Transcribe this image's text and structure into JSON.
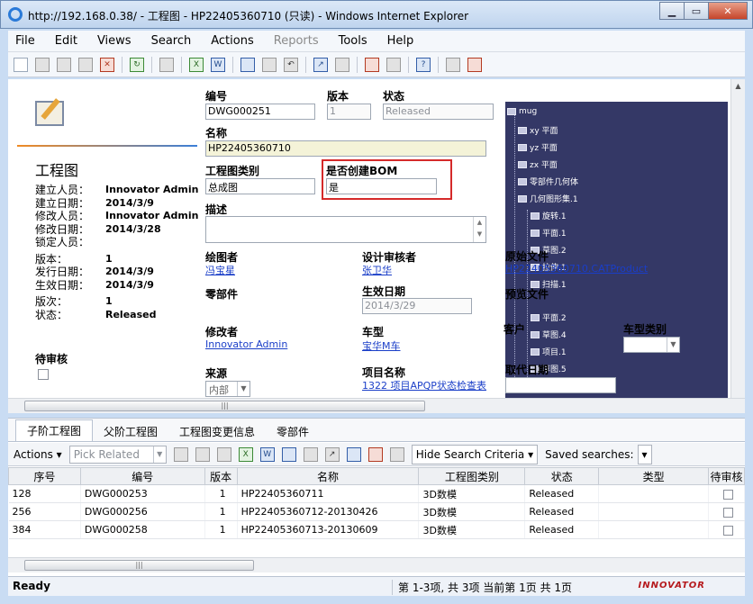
{
  "window": {
    "title": "http://192.168.0.38/ - 工程图 - HP22405360710 (只读) - Windows Internet Explorer"
  },
  "menu": [
    "File",
    "Edit",
    "Views",
    "Search",
    "Actions",
    "Reports",
    "Tools",
    "Help"
  ],
  "item": {
    "type_title": "工程图",
    "meta": [
      {
        "k": "建立人员：",
        "v": "Innovator Admin"
      },
      {
        "k": "建立日期：",
        "v": "2014/3/9"
      },
      {
        "k": "修改人员：",
        "v": "Innovator Admin"
      },
      {
        "k": "修改日期：",
        "v": "2014/3/28"
      },
      {
        "k": "锁定人员：",
        "v": ""
      },
      {
        "k": "版本：",
        "v": "1"
      },
      {
        "k": "发行日期：",
        "v": "2014/3/9"
      },
      {
        "k": "生效日期：",
        "v": "2014/3/9"
      },
      {
        "k": "版次：",
        "v": "1"
      },
      {
        "k": "状态：",
        "v": "Released"
      }
    ],
    "pending_review_label": "待审核"
  },
  "form": {
    "number_label": "编号",
    "number": "DWG000251",
    "version_label": "版本",
    "version": "1",
    "state_label": "状态",
    "state": "Released",
    "name_label": "名称",
    "name": "HP22405360710",
    "category_label": "工程图类别",
    "category": "总成图",
    "bom_label": "是否创建BOM",
    "bom": "是",
    "desc_label": "描述",
    "drawer_label": "绘图者",
    "drawer": "冯宝星",
    "reviewer_label": "设计审核者",
    "reviewer": "张卫华",
    "part_label": "零部件",
    "effective_label": "生效日期",
    "effective": "2014/3/29",
    "modifier_label": "修改者",
    "modifier": "Innovator Admin",
    "vehicle_label": "车型",
    "vehicle": "宝华M车",
    "source_label": "来源",
    "source": "内部",
    "project_label": "项目名称",
    "project": "1322 项目APQP状态检查表",
    "native_file_label": "原始文件",
    "native_file": "HP22405360710.CATProduct",
    "preview_label": "预览文件",
    "customer_label": "客户",
    "vehicle_type_label": "车型类别",
    "replace_date_label": "取代日期"
  },
  "tree": [
    "mug",
    "xy 平面",
    "yz 平面",
    "zx 平面",
    "零部件几何体",
    "几何图形集.1",
    "旋转.1",
    "平面.1",
    "草图.2",
    "拉伸.1",
    "扫描.1",
    "平面.2",
    "草图.4",
    "项目.1",
    "草图.5"
  ],
  "tabs": [
    "子阶工程图",
    "父阶工程图",
    "工程图变更信息",
    "零部件"
  ],
  "rel_toolbar": {
    "actions": "Actions",
    "pick_related": "Pick Related",
    "hide_search": "Hide Search Criteria",
    "saved_searches": "Saved searches:"
  },
  "grid": {
    "columns": [
      "序号",
      "编号",
      "版本",
      "名称",
      "工程图类别",
      "状态",
      "类型",
      "待审核"
    ],
    "rows": [
      [
        "128",
        "DWG000253",
        "1",
        "HP22405360711",
        "3D数模",
        "Released",
        ""
      ],
      [
        "256",
        "DWG000256",
        "1",
        "HP22405360712-20130426",
        "3D数模",
        "Released",
        ""
      ],
      [
        "384",
        "DWG000258",
        "1",
        "HP22405360713-20130609",
        "3D数模",
        "Released",
        ""
      ]
    ]
  },
  "status": {
    "ready": "Ready",
    "paging": "第 1-3项, 共 3项  当前第 1页 共 1页",
    "logo": "INNOVATOR"
  }
}
